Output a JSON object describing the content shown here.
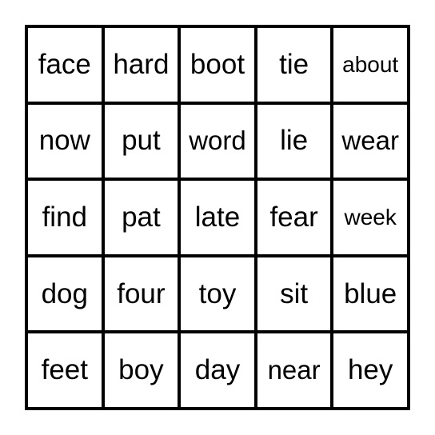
{
  "board": {
    "rows": [
      [
        "face",
        "hard",
        "boot",
        "tie",
        "about"
      ],
      [
        "now",
        "put",
        "word",
        "lie",
        "wear"
      ],
      [
        "find",
        "pat",
        "late",
        "fear",
        "week"
      ],
      [
        "dog",
        "four",
        "toy",
        "sit",
        "blue"
      ],
      [
        "feet",
        "boy",
        "day",
        "near",
        "hey"
      ]
    ]
  }
}
